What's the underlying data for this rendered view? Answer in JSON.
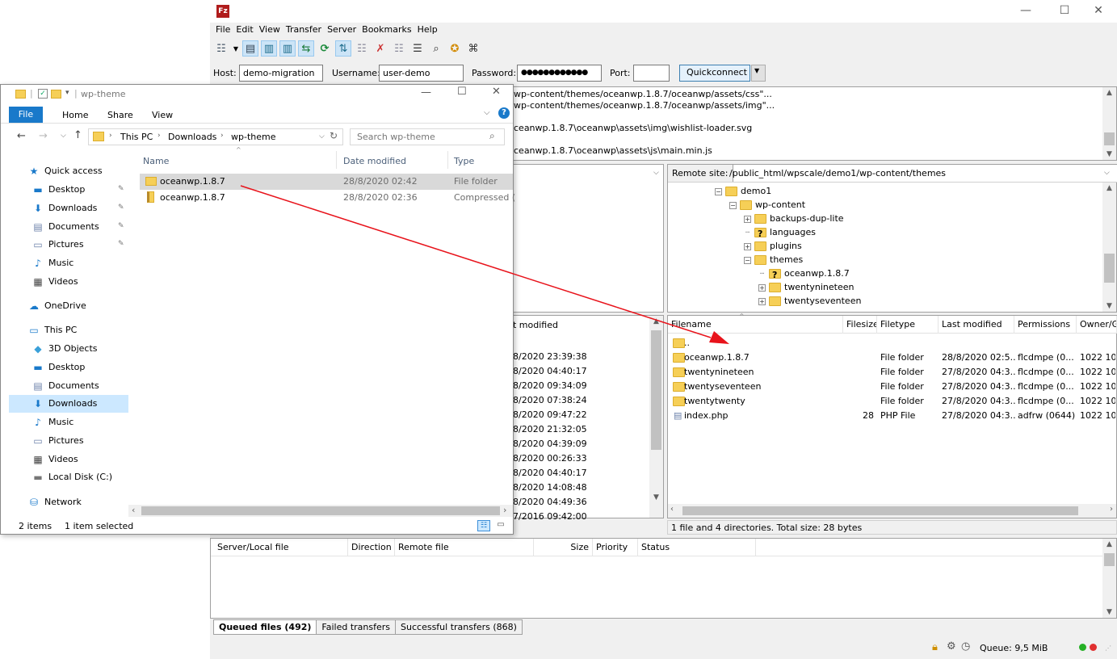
{
  "filezilla": {
    "menu": [
      "File",
      "Edit",
      "View",
      "Transfer",
      "Server",
      "Bookmarks",
      "Help"
    ],
    "quickconnect": {
      "host_label": "Host:",
      "host_value": "demo-migration",
      "username_label": "Username:",
      "username_value": "user-demo",
      "password_label": "Password:",
      "password_value": "●●●●●●●●●●●●",
      "port_label": "Port:",
      "port_value": "",
      "button": "Quickconnect"
    },
    "log": [
      "wp-content/themes/oceanwp.1.8.7/oceanwp/assets/css\"...",
      "wp-content/themes/oceanwp.1.8.7/oceanwp/assets/img\"...",
      "",
      "ceanwp.1.8.7\\oceanwp\\assets\\img\\wishlist-loader.svg",
      "",
      "ceanwp.1.8.7\\oceanwp\\assets\\js\\main.min.js"
    ],
    "remote_site_label": "Remote site:",
    "remote_site_path": "/public_html/wpscale/demo1/wp-content/themes",
    "remote_tree": [
      {
        "name": "demo1",
        "level": 0,
        "expander": "-",
        "icon": "folder"
      },
      {
        "name": "wp-content",
        "level": 1,
        "expander": "-",
        "icon": "folder"
      },
      {
        "name": "backups-dup-lite",
        "level": 2,
        "expander": "+",
        "icon": "folder"
      },
      {
        "name": "languages",
        "level": 2,
        "expander": "",
        "icon": "folder-q"
      },
      {
        "name": "plugins",
        "level": 2,
        "expander": "+",
        "icon": "folder"
      },
      {
        "name": "themes",
        "level": 2,
        "expander": "-",
        "icon": "folder"
      },
      {
        "name": "oceanwp.1.8.7",
        "level": 3,
        "expander": "",
        "icon": "folder-q"
      },
      {
        "name": "twentynineteen",
        "level": 3,
        "expander": "+",
        "icon": "folder"
      },
      {
        "name": "twentyseventeen",
        "level": 3,
        "expander": "+",
        "icon": "folder"
      }
    ],
    "local_list_header": "t modified",
    "local_dates": [
      "8/2020 23:39:38",
      "8/2020 04:40:17",
      "8/2020 09:34:09",
      "8/2020 07:38:24",
      "8/2020 09:47:22",
      "8/2020 21:32:05",
      "8/2020 04:39:09",
      "8/2020 00:26:33",
      "8/2020 04:40:17",
      "8/2020 14:08:48",
      "8/2020 04:49:36",
      "7/2016 09:42:00"
    ],
    "remote_headers": [
      "Filename",
      "Filesize",
      "Filetype",
      "Last modified",
      "Permissions",
      "Owner/G"
    ],
    "remote_files": [
      {
        "name": "..",
        "size": "",
        "type": "",
        "modified": "",
        "perm": "",
        "owner": "",
        "icon": "folder"
      },
      {
        "name": "oceanwp.1.8.7",
        "size": "",
        "type": "File folder",
        "modified": "28/8/2020 02:5...",
        "perm": "flcdmpe (0...",
        "owner": "1022 100",
        "icon": "folder"
      },
      {
        "name": "twentynineteen",
        "size": "",
        "type": "File folder",
        "modified": "27/8/2020 04:3...",
        "perm": "flcdmpe (0...",
        "owner": "1022 100",
        "icon": "folder"
      },
      {
        "name": "twentyseventeen",
        "size": "",
        "type": "File folder",
        "modified": "27/8/2020 04:3...",
        "perm": "flcdmpe (0...",
        "owner": "1022 100",
        "icon": "folder"
      },
      {
        "name": "twentytwenty",
        "size": "",
        "type": "File folder",
        "modified": "27/8/2020 04:3...",
        "perm": "flcdmpe (0...",
        "owner": "1022 100",
        "icon": "folder"
      },
      {
        "name": "index.php",
        "size": "28",
        "type": "PHP File",
        "modified": "27/8/2020 04:3...",
        "perm": "adfrw (0644)",
        "owner": "1022 100",
        "icon": "file"
      }
    ],
    "remote_status": "1 file and 4 directories. Total size: 28 bytes",
    "queue_headers": [
      "Server/Local file",
      "Direction",
      "Remote file",
      "Size",
      "Priority",
      "Status"
    ],
    "queue_tabs": [
      "Queued files (492)",
      "Failed transfers",
      "Successful transfers (868)"
    ],
    "queue_status": "Queue: 9,5 MiB"
  },
  "explorer": {
    "title": "wp-theme",
    "ribbon_tabs": [
      "File",
      "Home",
      "Share",
      "View"
    ],
    "breadcrumb": [
      "This PC",
      "Downloads",
      "wp-theme"
    ],
    "search_placeholder": "Search wp-theme",
    "columns": [
      "Name",
      "Date modified",
      "Type"
    ],
    "files": [
      {
        "name": "oceanwp.1.8.7",
        "date": "28/8/2020 02:42",
        "type": "File folder",
        "icon": "folder",
        "selected": true
      },
      {
        "name": "oceanwp.1.8.7",
        "date": "28/8/2020 02:36",
        "type": "Compressed (z",
        "icon": "zip",
        "selected": false
      }
    ],
    "nav": [
      {
        "label": "Quick access",
        "icon": "star-icon",
        "indent": 0,
        "pinned": false
      },
      {
        "label": "Desktop",
        "icon": "desktop-icon",
        "indent": 1,
        "pinned": true
      },
      {
        "label": "Downloads",
        "icon": "download-icon",
        "indent": 1,
        "pinned": true
      },
      {
        "label": "Documents",
        "icon": "document-icon",
        "indent": 1,
        "pinned": true
      },
      {
        "label": "Pictures",
        "icon": "picture-icon",
        "indent": 1,
        "pinned": true
      },
      {
        "label": "Music",
        "icon": "music-icon",
        "indent": 1,
        "pinned": false
      },
      {
        "label": "Videos",
        "icon": "video-icon",
        "indent": 1,
        "pinned": false
      },
      {
        "label": "OneDrive",
        "icon": "cloud-icon",
        "indent": 0,
        "pinned": false
      },
      {
        "label": "This PC",
        "icon": "computer-icon",
        "indent": 0,
        "pinned": false
      },
      {
        "label": "3D Objects",
        "icon": "cube-icon",
        "indent": 1,
        "pinned": false
      },
      {
        "label": "Desktop",
        "icon": "desktop-icon",
        "indent": 1,
        "pinned": false
      },
      {
        "label": "Documents",
        "icon": "document-icon",
        "indent": 1,
        "pinned": false
      },
      {
        "label": "Downloads",
        "icon": "download-icon",
        "indent": 1,
        "pinned": false,
        "selected": true
      },
      {
        "label": "Music",
        "icon": "music-icon",
        "indent": 1,
        "pinned": false
      },
      {
        "label": "Pictures",
        "icon": "picture-icon",
        "indent": 1,
        "pinned": false
      },
      {
        "label": "Videos",
        "icon": "video-icon",
        "indent": 1,
        "pinned": false
      },
      {
        "label": "Local Disk (C:)",
        "icon": "disk-icon",
        "indent": 1,
        "pinned": false
      },
      {
        "label": "Network",
        "icon": "network-icon",
        "indent": 0,
        "pinned": false
      }
    ],
    "status_items": "2 items",
    "status_selected": "1 item selected"
  },
  "colors": {
    "accent": "#0063b1",
    "selection": "#cce8ff",
    "arrow": "#e8131b"
  }
}
